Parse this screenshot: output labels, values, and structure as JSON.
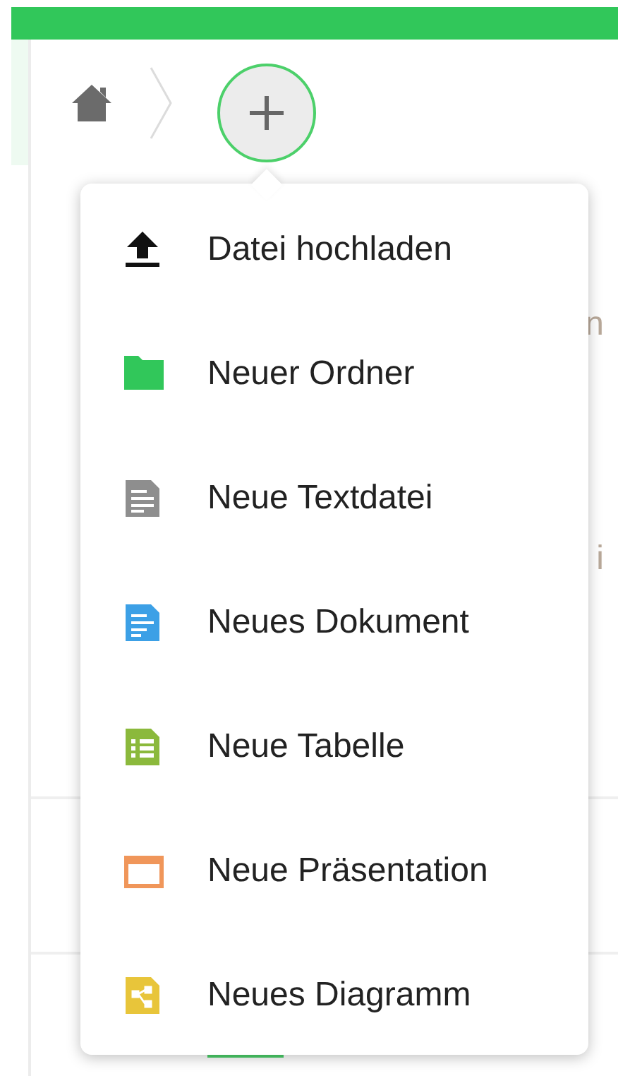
{
  "breadcrumb": {
    "add_button": {
      "expanded": true
    }
  },
  "background_fragments": [
    "n",
    "i"
  ],
  "menu": [
    {
      "kind": "upload",
      "label": "Datei hochladen"
    },
    {
      "kind": "folder",
      "label": "Neuer Ordner"
    },
    {
      "kind": "text",
      "label": "Neue Textdatei"
    },
    {
      "kind": "document",
      "label": "Neues Dokument"
    },
    {
      "kind": "spreadsheet",
      "label": "Neue Tabelle"
    },
    {
      "kind": "presentation",
      "label": "Neue Präsentation"
    },
    {
      "kind": "diagram",
      "label": "Neues Diagramm"
    }
  ]
}
